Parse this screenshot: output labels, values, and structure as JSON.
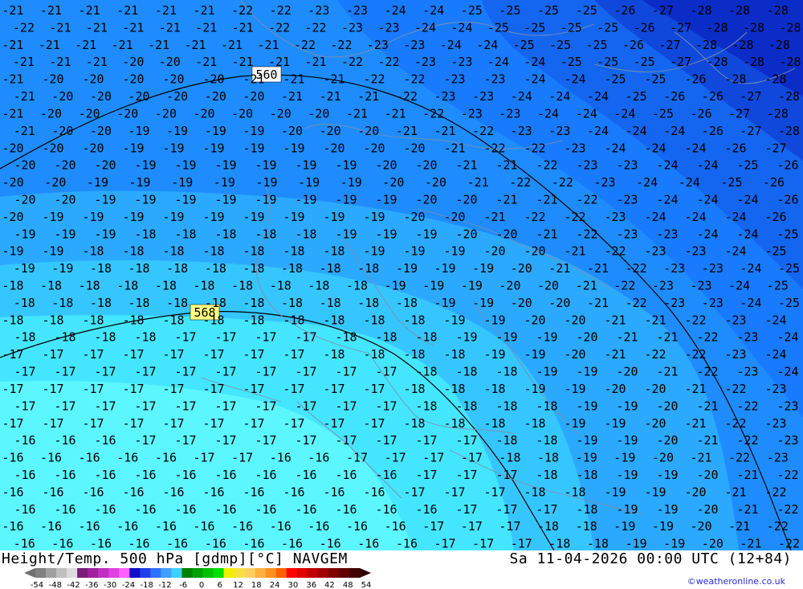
{
  "title_left": "Height/Temp. 500 hPa [gdmp][°C] NAVGEM",
  "title_right": "Sa 11-04-2026 00:00 UTC (12+84)",
  "credit": "©weatheronline.co.uk",
  "contour_labels": [
    "560",
    "568"
  ],
  "scale_ticks": [
    "-54",
    "-48",
    "-42",
    "-36",
    "-30",
    "-24",
    "-18",
    "-12",
    "-6",
    "0",
    "6",
    "12",
    "18",
    "24",
    "30",
    "36",
    "42",
    "48",
    "54"
  ],
  "scale_colors": [
    "#808080",
    "#a0a0a0",
    "#c0c0c0",
    "#dcdcdc",
    "#7a1e7a",
    "#a020a0",
    "#c030c0",
    "#e040e0",
    "#ff60ff",
    "#1010c8",
    "#2040e8",
    "#3070ff",
    "#40a0ff",
    "#40d0ff",
    "#008000",
    "#00a000",
    "#00c000",
    "#00e000",
    "#f0f000",
    "#f8e040",
    "#ffd060",
    "#ffb040",
    "#ff9020",
    "#ff6000",
    "#ff0000",
    "#e00000",
    "#c00000",
    "#a00000",
    "#800000",
    "#600000",
    "#400000"
  ],
  "temperature_rows": [
    [
      "-21",
      "-21",
      "-21",
      "-21",
      "-21",
      "-21",
      "-22",
      "-22",
      "-23",
      "-23",
      "-24",
      "-24",
      "-25",
      "-25",
      "-25",
      "-25",
      "-26",
      "-27",
      "-28",
      "-28",
      "-28"
    ],
    [
      "-22",
      "-21",
      "-21",
      "-21",
      "-21",
      "-21",
      "-21",
      "-22",
      "-22",
      "-23",
      "-23",
      "-24",
      "-24",
      "-25",
      "-25",
      "-25",
      "-25",
      "-26",
      "-27",
      "-28",
      "-28",
      "-28"
    ],
    [
      "-21",
      "-21",
      "-21",
      "-21",
      "-21",
      "-21",
      "-21",
      "-21",
      "-22",
      "-22",
      "-23",
      "-23",
      "-24",
      "-24",
      "-25",
      "-25",
      "-25",
      "-26",
      "-27",
      "-28",
      "-28",
      "-28"
    ],
    [
      "-21",
      "-21",
      "-21",
      "-20",
      "-20",
      "-21",
      "-21",
      "-21",
      "-21",
      "-22",
      "-22",
      "-23",
      "-23",
      "-24",
      "-24",
      "-25",
      "-25",
      "-25",
      "-27",
      "-28",
      "-28",
      "-28"
    ],
    [
      "-21",
      "-20",
      "-20",
      "-20",
      "-20",
      "-20",
      "-21",
      "-21",
      "-21",
      "-22",
      "-22",
      "-23",
      "-23",
      "-24",
      "-24",
      "-25",
      "-25",
      "-26",
      "-28",
      "-28"
    ],
    [
      "-21",
      "-20",
      "-20",
      "-20",
      "-20",
      "-20",
      "-20",
      "-21",
      "-21",
      "-21",
      "-22",
      "-23",
      "-23",
      "-24",
      "-24",
      "-24",
      "-25",
      "-26",
      "-26",
      "-27",
      "-28"
    ],
    [
      "-21",
      "-20",
      "-20",
      "-20",
      "-20",
      "-20",
      "-20",
      "-20",
      "-20",
      "-21",
      "-21",
      "-22",
      "-23",
      "-23",
      "-24",
      "-24",
      "-24",
      "-25",
      "-26",
      "-27",
      "-28"
    ],
    [
      "-21",
      "-20",
      "-20",
      "-19",
      "-19",
      "-19",
      "-19",
      "-20",
      "-20",
      "-20",
      "-21",
      "-21",
      "-22",
      "-23",
      "-23",
      "-24",
      "-24",
      "-24",
      "-26",
      "-27",
      "-28"
    ],
    [
      "-20",
      "-20",
      "-20",
      "-19",
      "-19",
      "-19",
      "-19",
      "-19",
      "-20",
      "-20",
      "-20",
      "-21",
      "-22",
      "-22",
      "-23",
      "-24",
      "-24",
      "-24",
      "-26",
      "-27"
    ],
    [
      "-20",
      "-20",
      "-20",
      "-19",
      "-19",
      "-19",
      "-19",
      "-19",
      "-19",
      "-20",
      "-20",
      "-21",
      "-21",
      "-22",
      "-23",
      "-23",
      "-24",
      "-24",
      "-25",
      "-26"
    ],
    [
      "-20",
      "-20",
      "-19",
      "-19",
      "-19",
      "-19",
      "-19",
      "-19",
      "-19",
      "-20",
      "-20",
      "-21",
      "-22",
      "-22",
      "-23",
      "-24",
      "-24",
      "-25",
      "-26"
    ],
    [
      "-20",
      "-20",
      "-19",
      "-19",
      "-19",
      "-19",
      "-19",
      "-19",
      "-19",
      "-19",
      "-20",
      "-20",
      "-21",
      "-21",
      "-22",
      "-23",
      "-24",
      "-24",
      "-24",
      "-26"
    ],
    [
      "-20",
      "-19",
      "-19",
      "-19",
      "-19",
      "-19",
      "-19",
      "-19",
      "-19",
      "-19",
      "-20",
      "-20",
      "-21",
      "-22",
      "-22",
      "-23",
      "-24",
      "-24",
      "-24",
      "-26"
    ],
    [
      "-19",
      "-19",
      "-19",
      "-18",
      "-18",
      "-18",
      "-18",
      "-18",
      "-19",
      "-19",
      "-19",
      "-20",
      "-20",
      "-21",
      "-22",
      "-23",
      "-23",
      "-24",
      "-24",
      "-25"
    ],
    [
      "-19",
      "-19",
      "-18",
      "-18",
      "-18",
      "-18",
      "-18",
      "-18",
      "-18",
      "-19",
      "-19",
      "-19",
      "-20",
      "-20",
      "-21",
      "-22",
      "-23",
      "-23",
      "-24",
      "-25"
    ],
    [
      "-19",
      "-19",
      "-18",
      "-18",
      "-18",
      "-18",
      "-18",
      "-18",
      "-18",
      "-18",
      "-19",
      "-19",
      "-19",
      "-20",
      "-21",
      "-21",
      "-22",
      "-23",
      "-23",
      "-24",
      "-25"
    ],
    [
      "-18",
      "-18",
      "-18",
      "-18",
      "-18",
      "-18",
      "-18",
      "-18",
      "-18",
      "-18",
      "-19",
      "-19",
      "-19",
      "-20",
      "-20",
      "-21",
      "-22",
      "-23",
      "-23",
      "-24",
      "-25"
    ],
    [
      "-18",
      "-18",
      "-18",
      "-18",
      "-18",
      "-18",
      "-18",
      "-18",
      "-18",
      "-18",
      "-18",
      "-19",
      "-19",
      "-20",
      "-20",
      "-21",
      "-22",
      "-23",
      "-23",
      "-24",
      "-25"
    ],
    [
      "-18",
      "-18",
      "-18",
      "-18",
      "-18",
      "-18",
      "-18",
      "-18",
      "-18",
      "-18",
      "-18",
      "-19",
      "-19",
      "-20",
      "-20",
      "-21",
      "-21",
      "-22",
      "-23",
      "-24"
    ],
    [
      "-18",
      "-18",
      "-18",
      "-18",
      "-17",
      "-17",
      "-17",
      "-17",
      "-18",
      "-18",
      "-18",
      "-19",
      "-19",
      "-19",
      "-20",
      "-21",
      "-21",
      "-22",
      "-23",
      "-24"
    ],
    [
      "-17",
      "-17",
      "-17",
      "-17",
      "-17",
      "-17",
      "-17",
      "-17",
      "-18",
      "-18",
      "-18",
      "-18",
      "-19",
      "-19",
      "-20",
      "-21",
      "-22",
      "-22",
      "-23",
      "-24"
    ],
    [
      "-17",
      "-17",
      "-17",
      "-17",
      "-17",
      "-17",
      "-17",
      "-17",
      "-17",
      "-17",
      "-18",
      "-18",
      "-18",
      "-19",
      "-19",
      "-20",
      "-21",
      "-22",
      "-23",
      "-24"
    ],
    [
      "-17",
      "-17",
      "-17",
      "-17",
      "-17",
      "-17",
      "-17",
      "-17",
      "-17",
      "-17",
      "-18",
      "-18",
      "-18",
      "-19",
      "-19",
      "-20",
      "-20",
      "-21",
      "-22",
      "-23"
    ],
    [
      "-17",
      "-17",
      "-17",
      "-17",
      "-17",
      "-17",
      "-17",
      "-17",
      "-17",
      "-17",
      "-18",
      "-18",
      "-18",
      "-18",
      "-19",
      "-19",
      "-20",
      "-21",
      "-22",
      "-23"
    ],
    [
      "-17",
      "-17",
      "-17",
      "-17",
      "-17",
      "-17",
      "-17",
      "-17",
      "-17",
      "-17",
      "-18",
      "-18",
      "-18",
      "-18",
      "-19",
      "-19",
      "-20",
      "-21",
      "-22",
      "-23"
    ],
    [
      "-16",
      "-16",
      "-16",
      "-17",
      "-17",
      "-17",
      "-17",
      "-17",
      "-17",
      "-17",
      "-17",
      "-17",
      "-18",
      "-18",
      "-19",
      "-19",
      "-20",
      "-21",
      "-22",
      "-23"
    ],
    [
      "-16",
      "-16",
      "-16",
      "-16",
      "-16",
      "-17",
      "-17",
      "-16",
      "-16",
      "-17",
      "-17",
      "-17",
      "-17",
      "-18",
      "-18",
      "-19",
      "-19",
      "-20",
      "-21",
      "-22",
      "-23"
    ],
    [
      "-16",
      "-16",
      "-16",
      "-16",
      "-16",
      "-16",
      "-16",
      "-16",
      "-16",
      "-16",
      "-17",
      "-17",
      "-17",
      "-18",
      "-18",
      "-19",
      "-19",
      "-20",
      "-21",
      "-22"
    ],
    [
      "-16",
      "-16",
      "-16",
      "-16",
      "-16",
      "-16",
      "-16",
      "-16",
      "-16",
      "-16",
      "-17",
      "-17",
      "-17",
      "-18",
      "-18",
      "-19",
      "-19",
      "-20",
      "-21",
      "-22"
    ],
    [
      "-16",
      "-16",
      "-16",
      "-16",
      "-16",
      "-16",
      "-16",
      "-16",
      "-16",
      "-16",
      "-16",
      "-17",
      "-17",
      "-17",
      "-18",
      "-19",
      "-19",
      "-20",
      "-21",
      "-22"
    ],
    [
      "-16",
      "-16",
      "-16",
      "-16",
      "-16",
      "-16",
      "-16",
      "-16",
      "-16",
      "-16",
      "-16",
      "-17",
      "-17",
      "-17",
      "-18",
      "-18",
      "-19",
      "-19",
      "-20",
      "-21",
      "-22"
    ],
    [
      "-16",
      "-16",
      "-16",
      "-16",
      "-16",
      "-16",
      "-16",
      "-16",
      "-16",
      "-16",
      "-16",
      "-17",
      "-17",
      "-17",
      "-18",
      "-18",
      "-19",
      "-19",
      "-20",
      "-21",
      "-22"
    ]
  ]
}
